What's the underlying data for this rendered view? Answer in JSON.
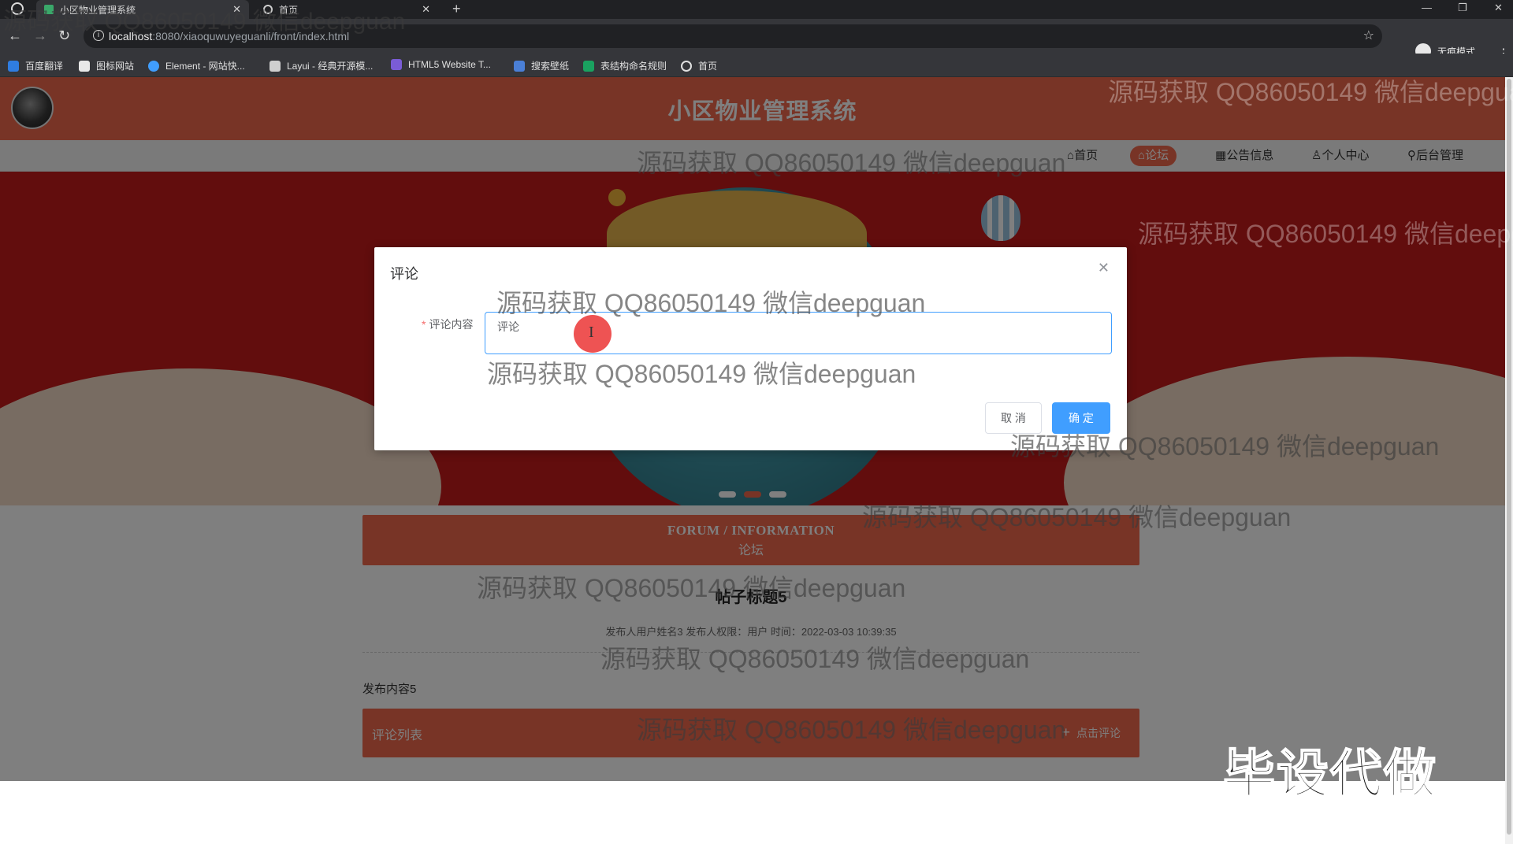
{
  "browser": {
    "tabs": [
      {
        "title": "小区物业管理系统",
        "active": true
      },
      {
        "title": "首页",
        "active": false
      }
    ],
    "url_host": "localhost",
    "url_path": ":8080/xiaoquwuyeguanli/front/index.html",
    "incognito_label": "无痕模式",
    "bookmarks": [
      "百度翻译",
      "图标网站",
      "Element - 网站快...",
      "Layui - 经典开源模...",
      "HTML5 Website T...",
      "搜索壁纸",
      "表结构命名规则",
      "首页"
    ]
  },
  "site": {
    "title": "小区物业管理系统",
    "nav": [
      "首页",
      "论坛",
      "公告信息",
      "个人中心",
      "后台管理"
    ],
    "active_nav": "论坛",
    "accent_color": "#f0684d"
  },
  "forum": {
    "banner_en": "FORUM / INFORMATION",
    "banner_cn": "论坛",
    "post_title": "帖子标题5",
    "post_meta": "发布人用户姓名3   发布人权限：用户   时间：2022-03-03 10:39:35",
    "post_content": "发布内容5",
    "comments_label": "评论列表",
    "add_comment_label": "点击评论"
  },
  "dialog": {
    "title": "评论",
    "field_label": "评论内容",
    "field_value": "评论",
    "cancel_label": "取 消",
    "confirm_label": "确 定",
    "primary_color": "#409eff"
  },
  "watermark_text": "源码获取 QQ86050149 微信deepguan",
  "promo_text": "毕设代做"
}
